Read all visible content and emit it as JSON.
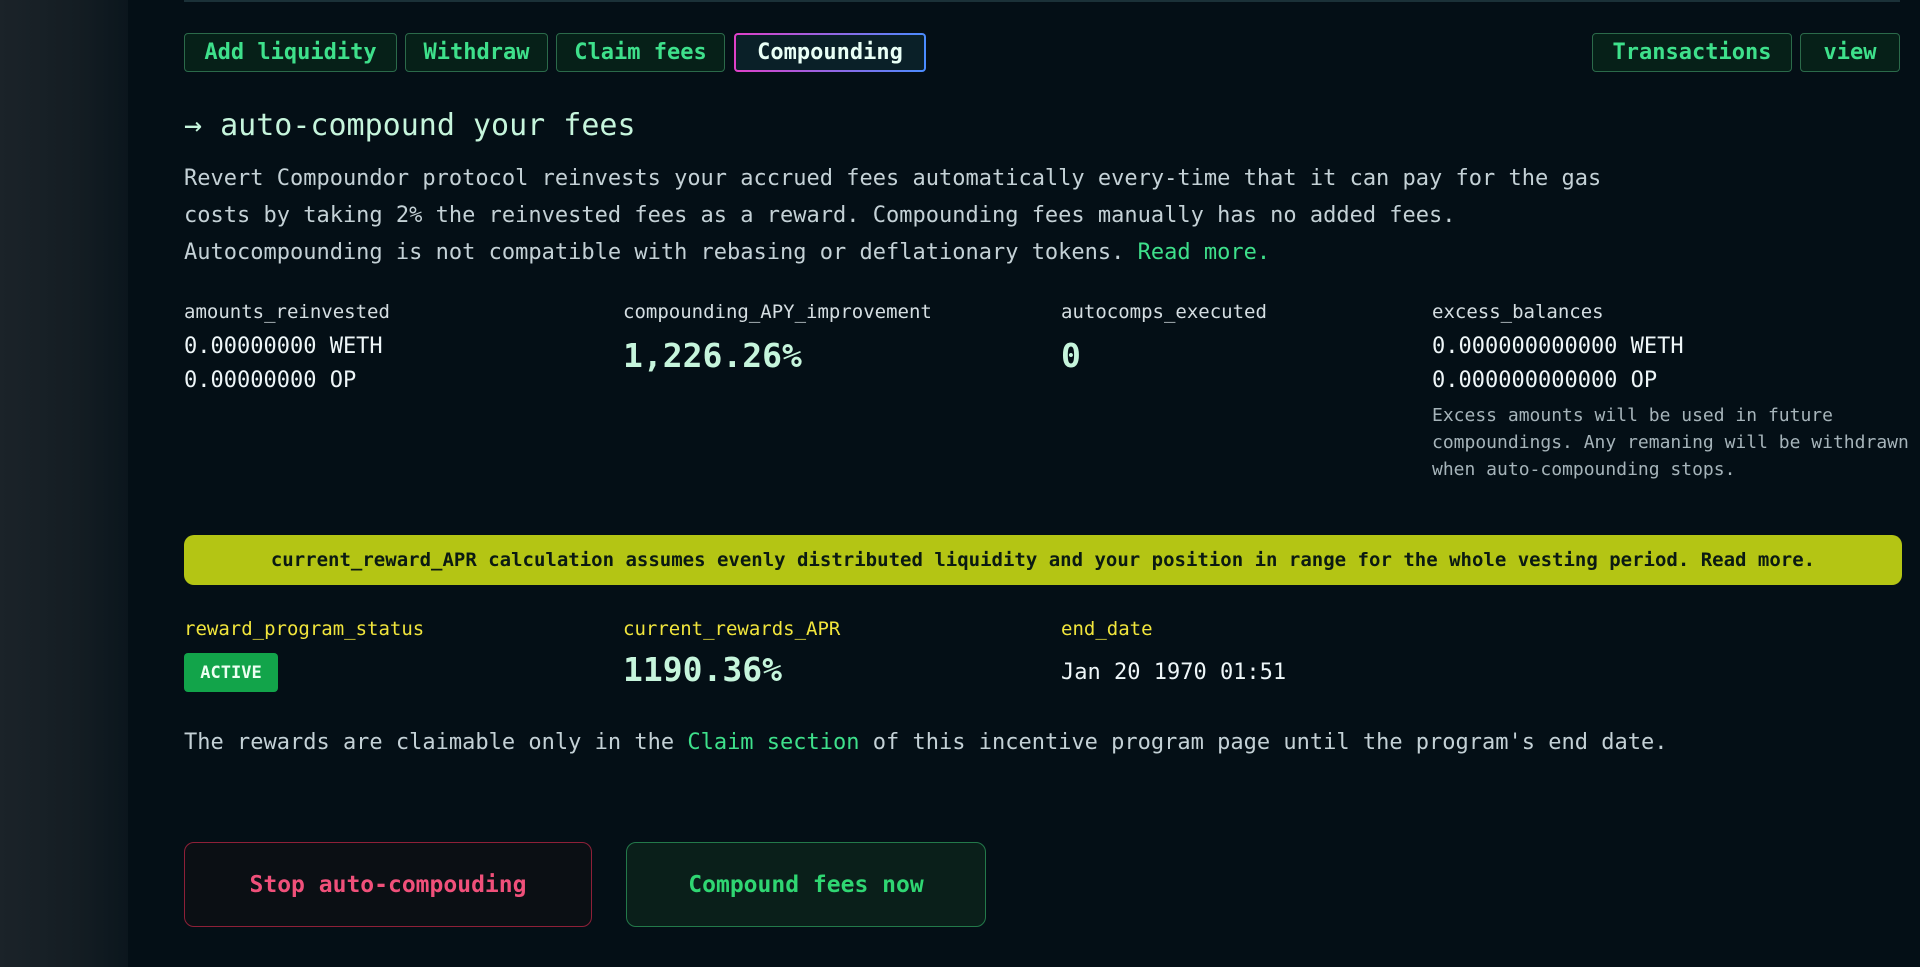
{
  "tabs": [
    {
      "label": "Add liquidity"
    },
    {
      "label": "Withdraw"
    },
    {
      "label": "Claim fees"
    },
    {
      "label": "Compounding"
    }
  ],
  "right_tabs": [
    {
      "label": "Transactions"
    },
    {
      "label": "view"
    }
  ],
  "heading": {
    "arrow": "→",
    "title": "auto-compound your fees"
  },
  "description": {
    "text": "Revert Compoundor protocol reinvests your accrued fees automatically every-time that it can pay for the gas costs by taking 2% the reinvested fees as a reward. Compounding fees manually has no added fees. Autocompounding is not compatible with rebasing or deflationary tokens.",
    "link": "Read more."
  },
  "stats": {
    "amounts_reinvested": {
      "label": "amounts_reinvested",
      "weth": "0.00000000 WETH",
      "op": "0.00000000 OP"
    },
    "apy_improvement": {
      "label": "compounding_APY_improvement",
      "value": "1,226.26%"
    },
    "autocomps": {
      "label": "autocomps_executed",
      "value": "0"
    },
    "excess": {
      "label": "excess_balances",
      "weth": "0.000000000000 WETH",
      "op": "0.000000000000 OP",
      "note": "Excess amounts will be used in future compoundings. Any remaning will be withdrawn when auto-compounding stops."
    }
  },
  "banner": "current_reward_APR calculation assumes evenly distributed liquidity and your position in range for the whole vesting period. Read more.",
  "reward": {
    "status_label": "reward_program_status",
    "status": "ACTIVE",
    "apr_label": "current_rewards_APR",
    "apr": "1190.36%",
    "end_label": "end_date",
    "end": "Jan 20 1970 01:51"
  },
  "claim": {
    "before": "The rewards are claimable only in the ",
    "link": "Claim section",
    "after": " of this incentive program page until the program's end date."
  },
  "buttons": {
    "stop": "Stop auto-compouding",
    "compound": "Compound fees now"
  },
  "colors": {
    "background": "#040f16",
    "accent_green": "#3ee08b",
    "banner_yellow": "#b4c514",
    "label_yellow": "#f1e53c",
    "danger": "#f0507a"
  }
}
